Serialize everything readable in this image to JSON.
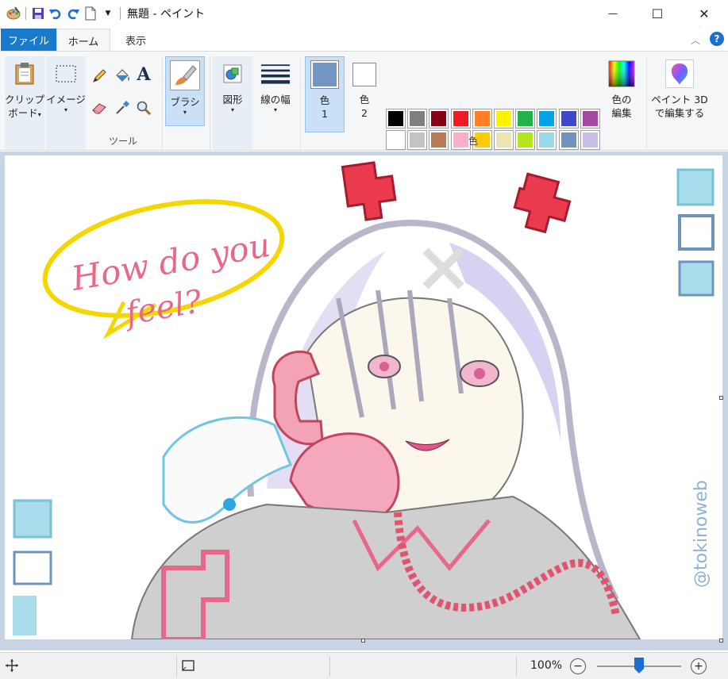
{
  "window": {
    "title": "無題 - ペイント",
    "minimize_glyph": "—",
    "maximize_glyph": "☐",
    "close_glyph": "✕"
  },
  "tabs": {
    "file": "ファイル",
    "home": "ホーム",
    "view": "表示"
  },
  "ribbon": {
    "clipboard": {
      "line1": "クリップ",
      "line2": "ボード"
    },
    "image": {
      "label": "イメージ"
    },
    "tools_group": "ツール",
    "text_tool_glyph": "A",
    "brush": {
      "label": "ブラシ"
    },
    "shapes": {
      "label": "図形"
    },
    "line_width": {
      "label": "線の幅"
    },
    "color1": {
      "line1": "色",
      "line2": "1",
      "color": "#7396c4"
    },
    "color2": {
      "line1": "色",
      "line2": "2",
      "color": "#ffffff"
    },
    "colors_group": "色",
    "edit_colors": {
      "line1": "色の",
      "line2": "編集"
    },
    "paint3d": {
      "line1": "ペイント 3D",
      "line2": "で編集する"
    },
    "palette_row1": [
      "#000000",
      "#7f7f7f",
      "#880015",
      "#ed1c24",
      "#ff7f27",
      "#fff200",
      "#22b14c",
      "#00a2e8",
      "#3f48cc",
      "#a349a4"
    ],
    "palette_row2": [
      "#ffffff",
      "#c3c3c3",
      "#b97a57",
      "#ffaec9",
      "#ffc90e",
      "#efe4b0",
      "#b5e61d",
      "#99d9ea",
      "#7092be",
      "#c8bfe7"
    ]
  },
  "canvas": {
    "speech_text_line1": "How do you",
    "speech_text_line2": "feel?",
    "signature": "@tokinoweb"
  },
  "status": {
    "zoom": "100%",
    "zoom_minus": "−",
    "zoom_plus": "+",
    "zoom_level_fraction": 0.5
  }
}
